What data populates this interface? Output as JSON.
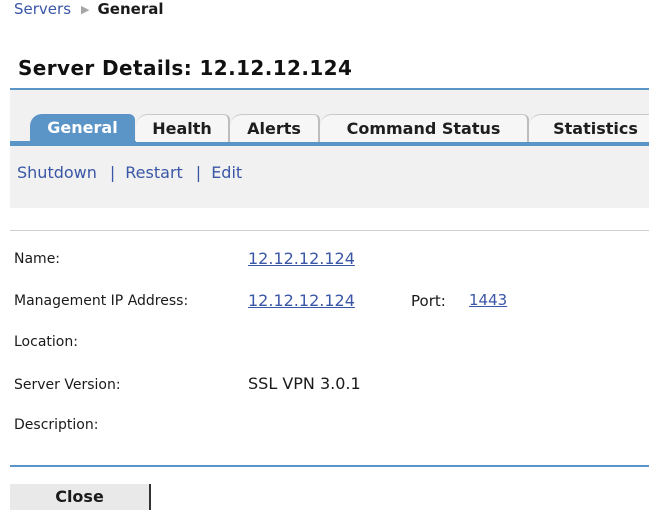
{
  "breadcrumb": {
    "parent": "Servers",
    "separator_icon": "triangle-right-icon",
    "current": "General"
  },
  "page": {
    "title": "Server Details: 12.12.12.124"
  },
  "tabs": [
    {
      "label": "General",
      "active": true
    },
    {
      "label": "Health",
      "active": false
    },
    {
      "label": "Alerts",
      "active": false
    },
    {
      "label": "Command Status",
      "active": false
    },
    {
      "label": "Statistics",
      "active": false
    }
  ],
  "actions": {
    "shutdown": "Shutdown",
    "restart": "Restart",
    "edit": "Edit",
    "separator": "|"
  },
  "details": {
    "name_label": "Name:",
    "name_value": "12.12.12.124",
    "mgmt_ip_label": "Management IP Address:",
    "mgmt_ip_value": "12.12.12.124",
    "port_label": "Port:",
    "port_value": "1443",
    "location_label": "Location:",
    "location_value": "",
    "version_label": "Server Version:",
    "version_value": "SSL VPN 3.0.1",
    "description_label": "Description:",
    "description_value": ""
  },
  "footer": {
    "close_label": "Close"
  },
  "colors": {
    "accent": "#5b94c6",
    "link": "#3a56a6",
    "band": "#f1f1f1"
  }
}
